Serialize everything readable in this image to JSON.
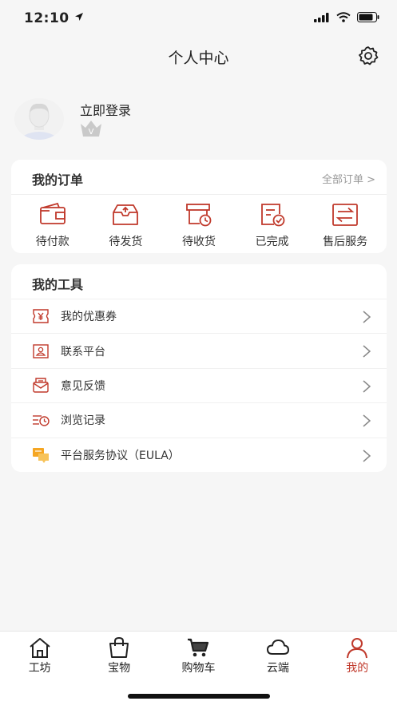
{
  "status": {
    "time": "12:10"
  },
  "header": {
    "title": "个人中心"
  },
  "profile": {
    "login_label": "立即登录",
    "vip_letter": "V"
  },
  "orders": {
    "title": "我的订单",
    "all_link": "全部订单 >",
    "items": [
      {
        "label": "待付款",
        "icon": "wallet-icon"
      },
      {
        "label": "待发货",
        "icon": "package-box-icon"
      },
      {
        "label": "待收货",
        "icon": "delivery-clock-icon"
      },
      {
        "label": "已完成",
        "icon": "completed-check-icon"
      },
      {
        "label": "售后服务",
        "icon": "exchange-icon"
      }
    ]
  },
  "tools": {
    "title": "我的工具",
    "items": [
      {
        "label": "我的优惠券",
        "icon": "coupon-icon"
      },
      {
        "label": "联系平台",
        "icon": "contact-card-icon"
      },
      {
        "label": "意见反馈",
        "icon": "feedback-mail-icon"
      },
      {
        "label": "浏览记录",
        "icon": "history-icon"
      },
      {
        "label": "平台服务协议（EULA）",
        "icon": "agreement-chat-icon"
      }
    ]
  },
  "tabbar": {
    "items": [
      {
        "label": "工坊",
        "icon": "home-icon"
      },
      {
        "label": "宝物",
        "icon": "shopping-bag-icon"
      },
      {
        "label": "购物车",
        "icon": "cart-icon"
      },
      {
        "label": "云端",
        "icon": "cloud-icon"
      },
      {
        "label": "我的",
        "icon": "user-icon",
        "active": true
      }
    ]
  },
  "colors": {
    "accent": "#c0392b",
    "background": "#f6f6f6",
    "card": "#ffffff"
  }
}
